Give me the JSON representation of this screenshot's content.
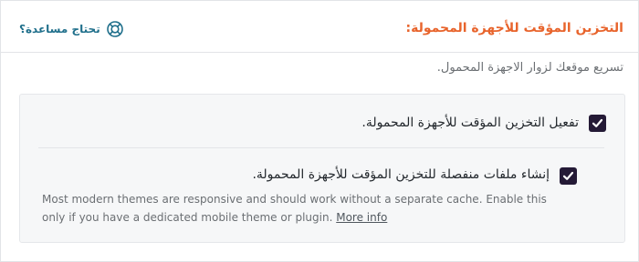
{
  "header": {
    "title": "التخزين المؤقت للأجهزة المحمولة:",
    "help_label": "تحتاج مساعدة؟",
    "help_icon": "lifebuoy-icon"
  },
  "subtitle": "تسريع موقعك لزوار الاجهزة المحمول.",
  "options": [
    {
      "label": "تفعيل التخزين المؤقت للأجهزة المحمولة.",
      "checked": true
    },
    {
      "label": "إنشاء ملفات منفصلة للتخزين المؤقت للأجهزة المحمولة.",
      "checked": true
    }
  ],
  "description": {
    "text": "Most modern themes are responsive and should work without a separate cache. Enable this only if you have a dedicated mobile theme or plugin.",
    "link_label": "More info"
  },
  "colors": {
    "title": "#e8642c",
    "help": "#1f6f8b",
    "checkbox": "#241a36"
  }
}
